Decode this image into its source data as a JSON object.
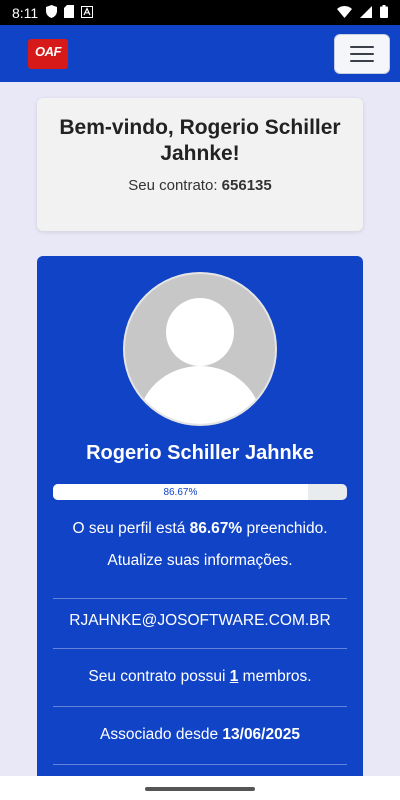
{
  "status": {
    "time": "8:11"
  },
  "welcome": {
    "title": "Bem-vindo, Rogerio Schiller Jahnke!",
    "contract_label": "Seu contrato:",
    "contract_number": "656135"
  },
  "profile": {
    "name": "Rogerio Schiller Jahnke",
    "progress": 86.67,
    "progress_label": "86.67%",
    "filled_prefix": "O seu perfil está",
    "filled_value": "86.67%",
    "filled_suffix": "preenchido.",
    "update_link": "Atualize suas informações.",
    "email": "RJAHNKE@JOSOFTWARE.COM.BR",
    "members_prefix": "Seu contrato possui",
    "members_count": "1",
    "members_suffix": "membros.",
    "since_prefix": "Associado desde",
    "since_date": "13/06/2025"
  },
  "colors": {
    "primary": "#1043c6",
    "logo": "#d61a1a"
  }
}
